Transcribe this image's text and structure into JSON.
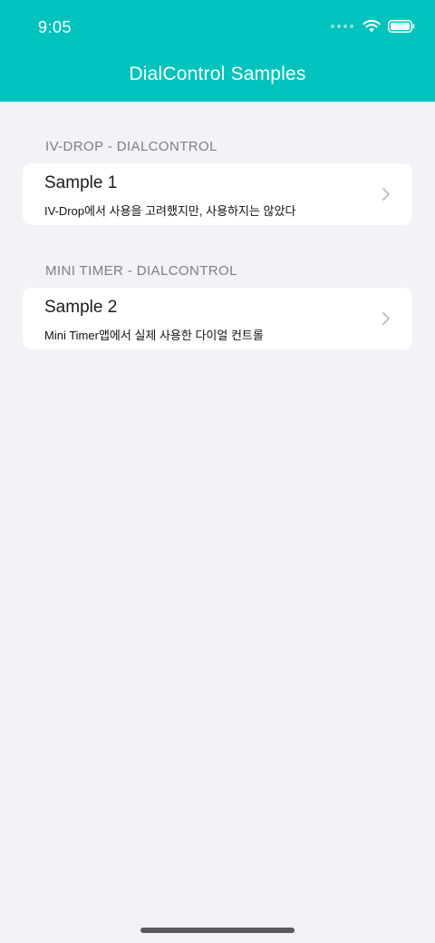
{
  "status_bar": {
    "time": "9:05"
  },
  "nav": {
    "title": "DialControl Samples"
  },
  "sections": [
    {
      "header": "IV-DROP - DIALCONTROL",
      "rows": [
        {
          "title": "Sample 1",
          "subtitle": "IV-Drop에서 사용을 고려했지만, 사용하지는 않았다"
        }
      ]
    },
    {
      "header": "MINI TIMER - DIALCONTROL",
      "rows": [
        {
          "title": "Sample 2",
          "subtitle": "Mini Timer앱에서 실제 사용한 다이얼 컨트롤"
        }
      ]
    }
  ],
  "colors": {
    "accent": "#00c3bd",
    "background": "#f2f2f7",
    "chevron": "#c4c4c7"
  },
  "icons": [
    "signal-dots-icon",
    "wifi-icon",
    "battery-icon",
    "chevron-right-icon"
  ]
}
